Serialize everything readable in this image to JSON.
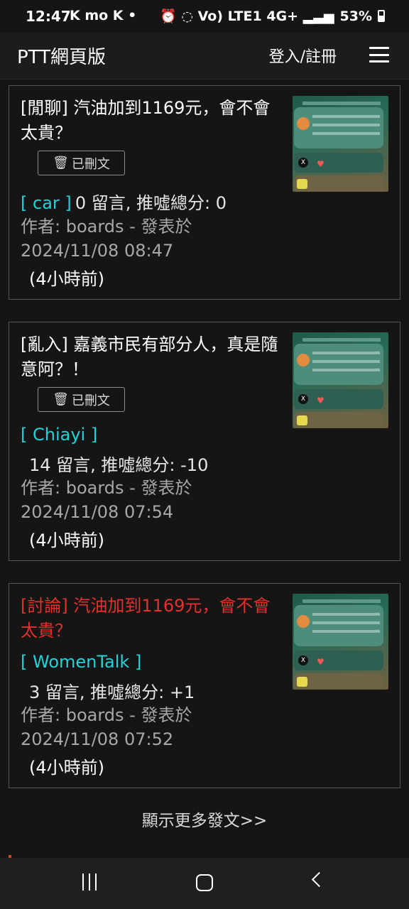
{
  "status_bar": {
    "time": "12:47",
    "left_icons": "K mo K •",
    "right_icons": "⏰ ◌ Vo) LTE1 4G+ ▂▃▅",
    "battery": "53%"
  },
  "nav": {
    "brand": "PTT網頁版",
    "login": "登入/註冊",
    "menu_icon": "hamburger-icon"
  },
  "posts": [
    {
      "title": "[閒聊] 汽油加到1169元，會不會太貴？",
      "deleted_label": "已刪文",
      "board": "[ car ]",
      "stats": " 0 留言, 推噓總分: 0",
      "author": "作者: boards - 發表於",
      "date": "2024/11/08 08:47",
      "relative": "(4小時前)"
    },
    {
      "title": "[亂入] 嘉義市民有部分人，真是隨意阿？！",
      "deleted_label": "已刪文",
      "board": "[ Chiayi ]",
      "stats": "14 留言, 推噓總分: -10",
      "author": "作者: boards - 發表於",
      "date": "2024/11/08 07:54",
      "relative": "(4小時前)"
    },
    {
      "title": "[討論] 汽油加到1169元，會不會太貴？",
      "board": "[ WomenTalk ]",
      "stats": "3 留言, 推噓總分: +1",
      "author": "作者: boards - 發表於",
      "date": "2024/11/08 07:52",
      "relative": "(4小時前)"
    }
  ],
  "load_more": "顯示更多發文>>",
  "colors": {
    "board_link": "#21d3d8",
    "discussion_title": "#e3312d",
    "background": "#151515"
  }
}
